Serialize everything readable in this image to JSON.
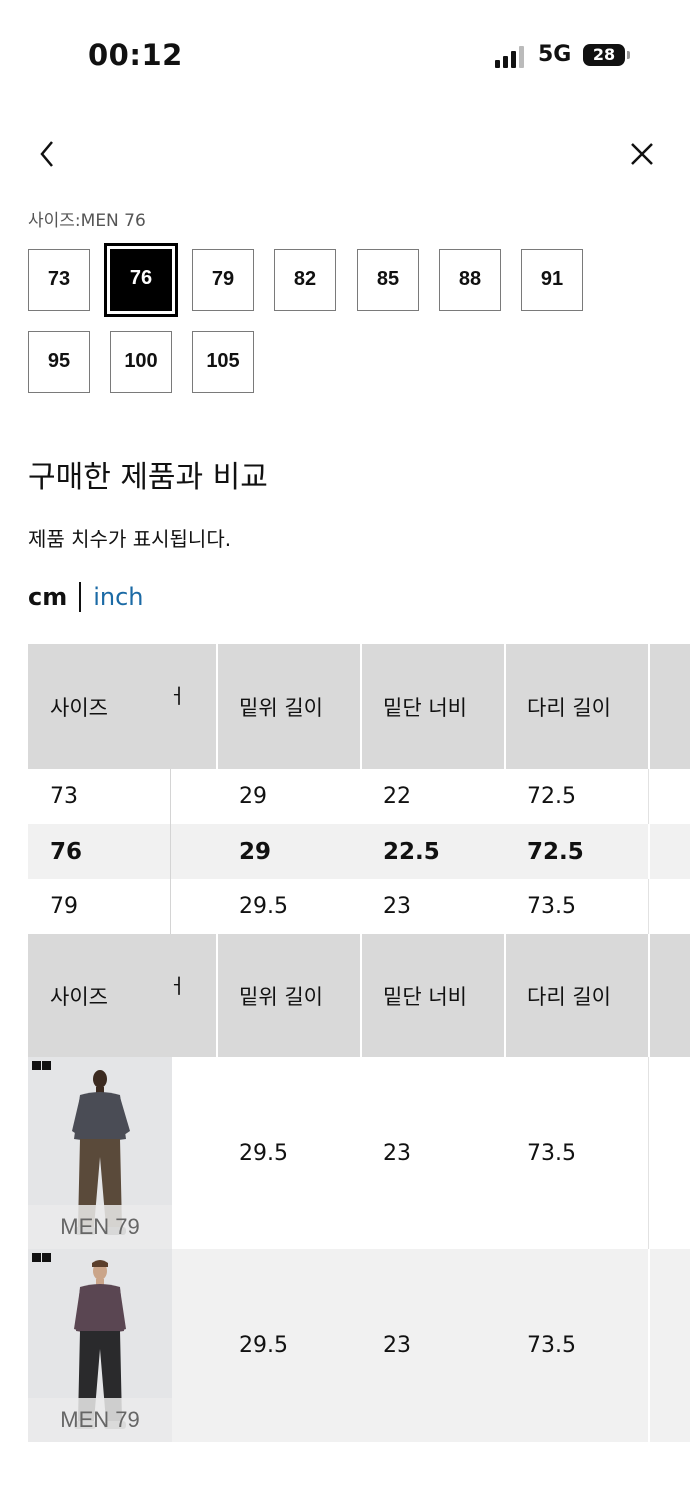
{
  "status": {
    "time": "00:12",
    "network": "5G",
    "battery": "28"
  },
  "selector": {
    "label": "사이즈:MEN 76",
    "sizes": [
      "73",
      "76",
      "79",
      "82",
      "85",
      "88",
      "91",
      "95",
      "100",
      "105"
    ],
    "selected": "76"
  },
  "compare": {
    "title": "구매한 제품과 비교",
    "subtitle": "제품 치수가 표시됩니다."
  },
  "units": {
    "cm": "cm",
    "inch": "inch"
  },
  "table": {
    "headers": [
      "사이즈",
      "밑위 길이",
      "밑단 너비",
      "다리 길이"
    ],
    "header_fragment": "ㅓ",
    "rows": [
      [
        "73",
        "29",
        "22",
        "72.5"
      ],
      [
        "76",
        "29",
        "22.5",
        "72.5"
      ],
      [
        "79",
        "29.5",
        "23",
        "73.5"
      ]
    ],
    "photo_rows": [
      {
        "label": "MEN 79",
        "values": [
          "29.5",
          "23",
          "73.5"
        ]
      },
      {
        "label": "MEN 79",
        "values": [
          "29.5",
          "23",
          "73.5"
        ]
      }
    ]
  }
}
